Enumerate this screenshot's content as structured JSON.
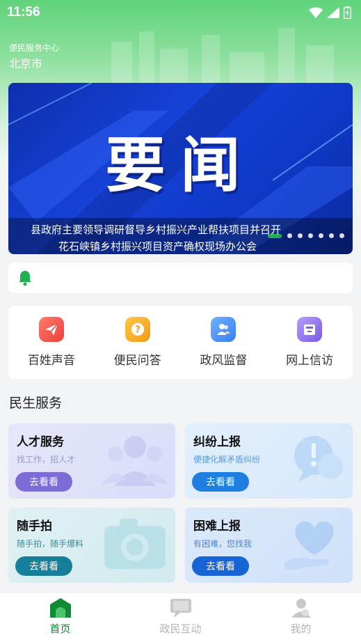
{
  "status_bar": {
    "time": "11:56"
  },
  "header": {
    "subtitle": "便民服务中心",
    "city": "北京市"
  },
  "banner": {
    "title": "要闻",
    "caption_line1": "县政府主要领导调研督导乡村振兴产业帮扶项目并召开",
    "caption_line2": "花石峡镇乡村振兴项目资产确权现场办公会",
    "dot_count": 7,
    "active_index": 0
  },
  "notice": {
    "icon": "bell-icon",
    "text": ""
  },
  "quick_actions": [
    {
      "label": "百姓声音",
      "icon": "paper-plane-icon",
      "color": "#f2564d"
    },
    {
      "label": "便民问答",
      "icon": "question-bubble-icon",
      "color": "#f5a623"
    },
    {
      "label": "政风监督",
      "icon": "users-icon",
      "color": "#4a8ff7"
    },
    {
      "label": "网上信访",
      "icon": "mailbox-icon",
      "color": "#8c6cf2"
    }
  ],
  "section": {
    "title": "民生服务"
  },
  "cards": [
    {
      "title": "人才服务",
      "subtitle": "找工作，招人才",
      "button": "去看看",
      "icon": "people-icon",
      "accent": "#7b6cd6"
    },
    {
      "title": "纠纷上报",
      "subtitle": "便捷化解矛盾纠纷",
      "button": "去看看",
      "icon": "alert-chat-icon",
      "accent": "#1f7fe0"
    },
    {
      "title": "随手拍",
      "subtitle": "随手拍，随手爆料",
      "button": "去看看",
      "icon": "camera-icon",
      "accent": "#16809b"
    },
    {
      "title": "困难上报",
      "subtitle": "有困难，您找我",
      "button": "去看看",
      "icon": "heart-hand-icon",
      "accent": "#1765d4"
    }
  ],
  "bottom_nav": [
    {
      "label": "首页",
      "icon": "home-icon",
      "active": true
    },
    {
      "label": "政民互动",
      "icon": "chat-icon",
      "active": false
    },
    {
      "label": "我的",
      "icon": "user-icon",
      "active": false
    }
  ],
  "colors": {
    "primary_green": "#0f8a35",
    "inactive_gray": "#b5b5b5"
  }
}
